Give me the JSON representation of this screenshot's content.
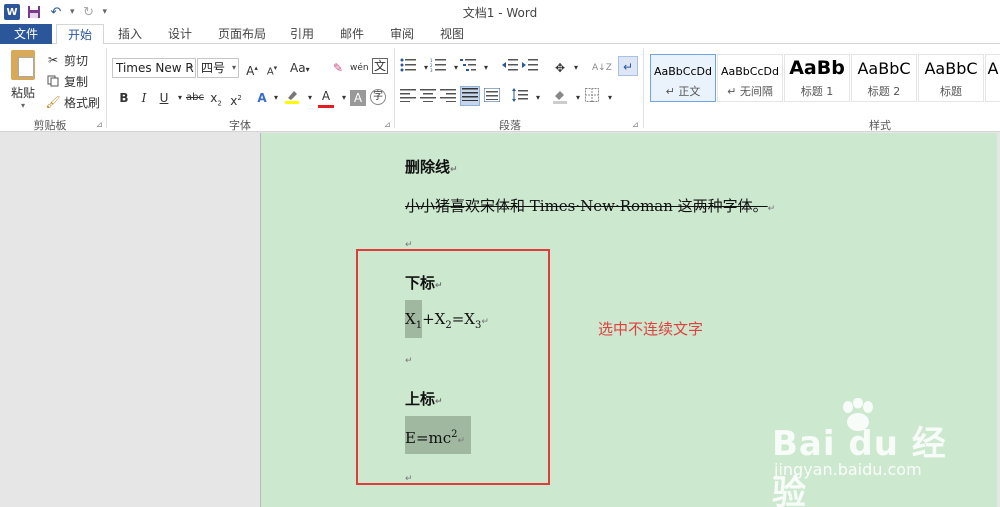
{
  "window": {
    "title": "文档1 - Word"
  },
  "qat": {
    "undo_arrow": "▾",
    "customize": "▾"
  },
  "tabs": [
    {
      "label": "文件"
    },
    {
      "label": "开始"
    },
    {
      "label": "插入"
    },
    {
      "label": "设计"
    },
    {
      "label": "页面布局"
    },
    {
      "label": "引用"
    },
    {
      "label": "邮件"
    },
    {
      "label": "审阅"
    },
    {
      "label": "视图"
    }
  ],
  "clipboard": {
    "paste_label": "粘贴",
    "cut_label": "剪切",
    "copy_label": "复制",
    "format_painter_label": "格式刷",
    "group_label": "剪贴板"
  },
  "font": {
    "font_name": "Times New R",
    "font_size": "四号",
    "group_label": "字体",
    "grow": "A",
    "shrink": "A",
    "change_case": "Aa",
    "bold": "B",
    "italic": "I",
    "underline": "U",
    "strikethrough": "abc",
    "subscript": "x",
    "superscript": "x",
    "font_color": "A",
    "char_shading": "A"
  },
  "paragraph": {
    "group_label": "段落"
  },
  "styles": {
    "group_label": "样式",
    "items": [
      {
        "sample": "AaBbCcDd",
        "name": "↵ 正文"
      },
      {
        "sample": "AaBbCcDd",
        "name": "↵ 无间隔"
      },
      {
        "sample": "AaBb",
        "name": "标题 1"
      },
      {
        "sample": "AaBbC",
        "name": "标题 2"
      },
      {
        "sample": "AaBbC",
        "name": "标题"
      }
    ]
  },
  "document": {
    "heading_strike": "删除线",
    "strike_text": "小小猪喜欢宋体和 Times·New·Roman 这两种字体。",
    "heading_sub": "下标",
    "sub_x": "X",
    "sub_1": "1",
    "sub_plus": "+X",
    "sub_2": "2",
    "sub_eq": "=X",
    "sub_3": "3",
    "heading_sup": "上标",
    "sup_base": "E=mc",
    "sup_exp": "2",
    "para_mark": "↵"
  },
  "annotation": {
    "text": "选中不连续文字"
  },
  "watermark": {
    "logo_text": "Bai du 经验",
    "url": "jingyan.baidu.com"
  },
  "colors": {
    "word_blue": "#2b579a",
    "page_bg": "#cce8cf",
    "annotation_red": "#e03c3c",
    "selection": "#9fb89f"
  }
}
